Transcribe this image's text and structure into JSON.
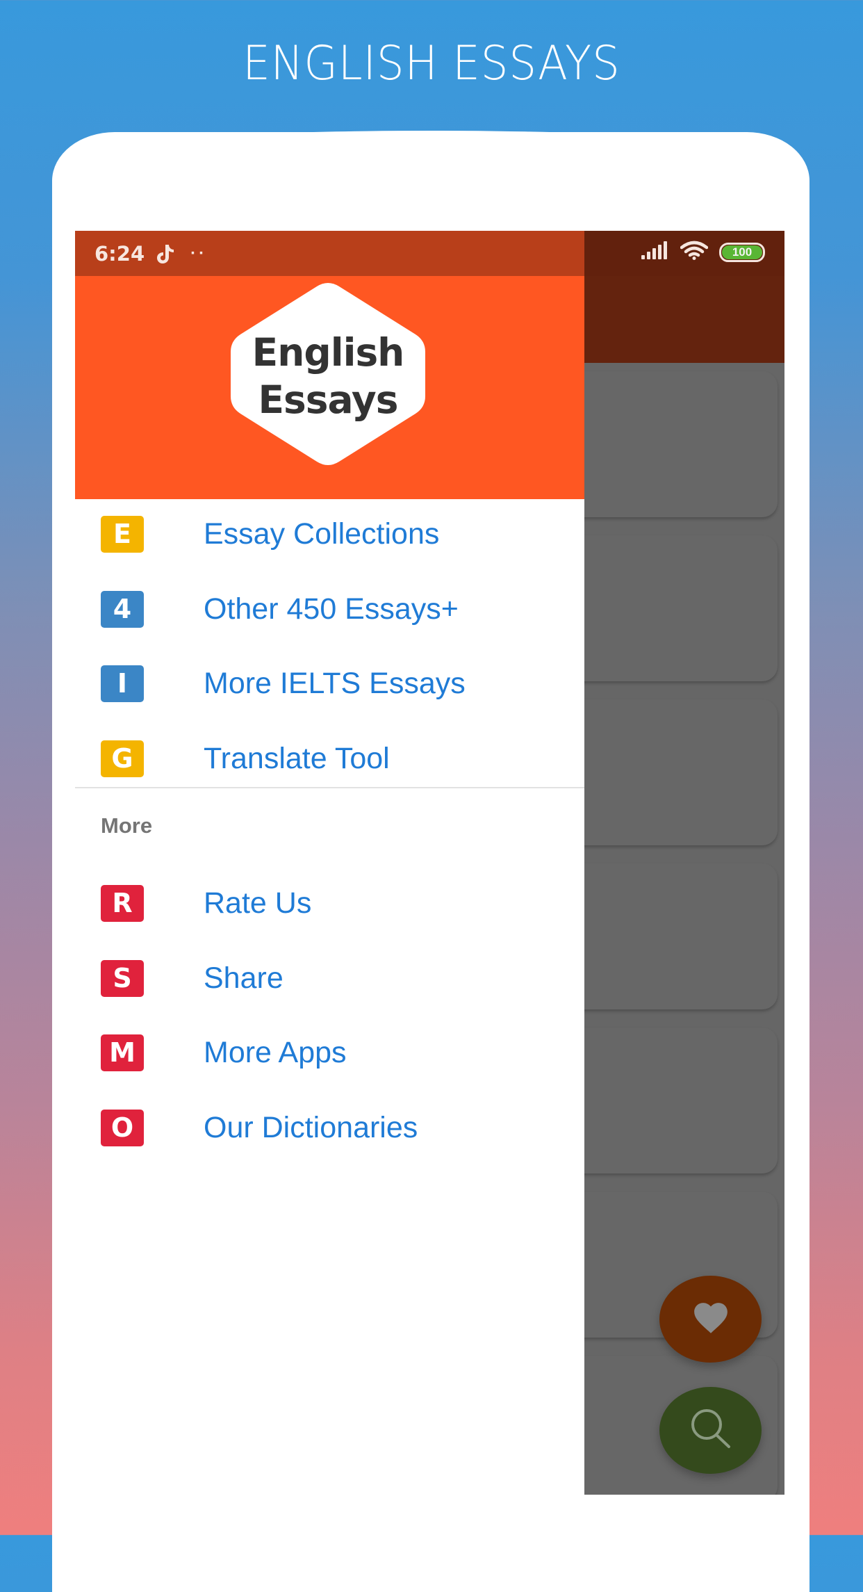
{
  "promo": {
    "title": "ENGLISH ESSAYS"
  },
  "status_bar": {
    "time": "6:24",
    "notification_icons": [
      "tiktok-icon",
      "more-dots-icon"
    ],
    "dots": "··",
    "signal_icon": "cellular-signal-icon",
    "wifi_icon": "wifi-icon",
    "battery_level": "100"
  },
  "drawer": {
    "logo": {
      "line1": "English",
      "line2": "Essays"
    },
    "primary_items": [
      {
        "badge": "E",
        "label": "Essay Collections",
        "color": "#f4b400"
      },
      {
        "badge": "4",
        "label": "Other 450 Essays+",
        "color": "#3b86c6"
      },
      {
        "badge": "I",
        "label": "More IELTS Essays",
        "color": "#3b86c6"
      },
      {
        "badge": "G",
        "label": "Translate Tool",
        "color": "#f4b400"
      }
    ],
    "section_title": "More",
    "secondary_items": [
      {
        "badge": "R",
        "label": "Rate Us",
        "color": "#e0223c"
      },
      {
        "badge": "S",
        "label": "Share",
        "color": "#e0223c"
      },
      {
        "badge": "M",
        "label": "More Apps",
        "color": "#e0223c"
      },
      {
        "badge": "O",
        "label": "Our Dictionaries",
        "color": "#e0223c"
      }
    ]
  },
  "background_app": {
    "fab_favorite_icon": "heart-icon",
    "fab_search_icon": "search-icon"
  },
  "colors": {
    "drawer_header": "#ff5722",
    "drawer_statusbar": "#b83f1a",
    "link_text": "#1f7bd6",
    "scrim_gray": "#666666"
  }
}
